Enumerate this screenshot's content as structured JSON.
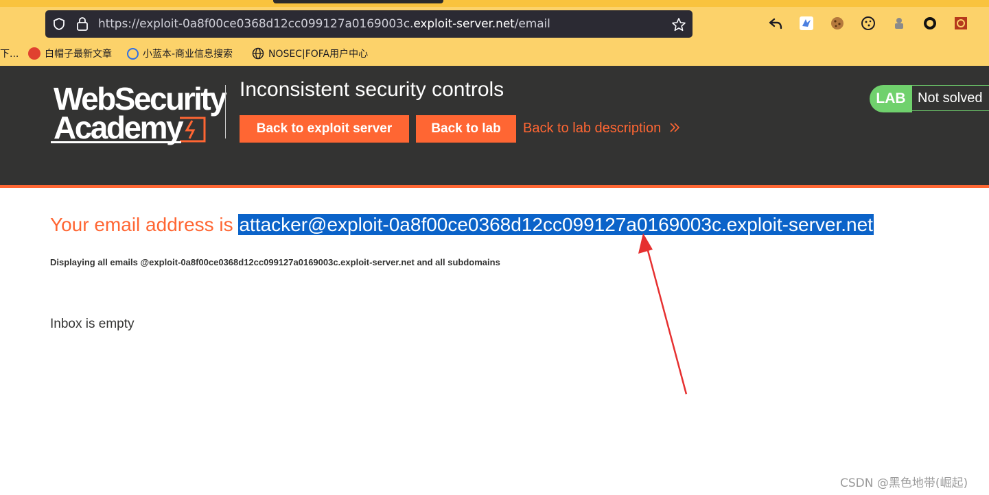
{
  "browser": {
    "url_prefix": "https://exploit-0a8f00ce0368d12cc099127a0169003c.",
    "url_host": "exploit-server.net",
    "url_path": "/email",
    "bookmarks": [
      {
        "label": "下..."
      },
      {
        "label": "白帽子最新文章"
      },
      {
        "label": "小蓝本-商业信息搜索"
      },
      {
        "label": "NOSEC|FOFA用户中心"
      }
    ]
  },
  "header": {
    "logo_line1": "WebSecurity",
    "logo_line2": "Academy",
    "lab_title": "Inconsistent security controls",
    "back_to_exploit_server": "Back to exploit server",
    "back_to_lab": "Back to lab",
    "back_to_description": "Back to lab description",
    "lab_badge": "LAB",
    "lab_status": "Not solved"
  },
  "content": {
    "email_prefix": "Your email address is ",
    "email_address": "attacker@exploit-0a8f00ce0368d12cc099127a0169003c.exploit-server.net",
    "displaying": "Displaying all emails @exploit-0a8f00ce0368d12cc099127a0169003c.exploit-server.net and all subdomains",
    "inbox": "Inbox is empty"
  },
  "watermark": "CSDN @黑色地带(崛起)",
  "colors": {
    "accent": "#ff6633",
    "header_bg": "#333332",
    "lab_green": "#70d16d",
    "selection": "#0b63c9",
    "chrome": "#fcd26a"
  }
}
